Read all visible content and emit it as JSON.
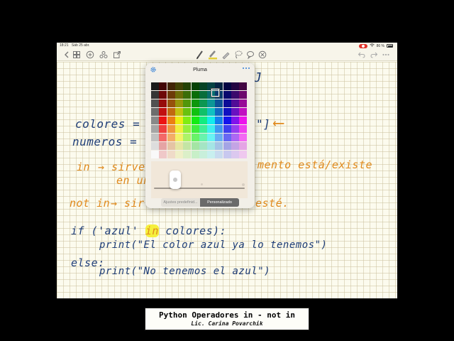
{
  "status_bar": {
    "time": "18:21",
    "date": "Sáb 25 abr.",
    "battery": "86 %",
    "icons": [
      "recording-icon",
      "wifi-icon",
      "battery-icon"
    ]
  },
  "toolbar": {
    "left_icons": [
      "back-icon",
      "thumbnails-icon",
      "add-page-icon",
      "shapes-icon",
      "export-icon"
    ],
    "tools": [
      "pen-icon",
      "highlighter-icon",
      "eraser-icon",
      "lasso-icon",
      "bubble-icon",
      "close-icon"
    ],
    "right_icons": [
      "undo-icon",
      "redo-icon",
      "more-icon"
    ],
    "active_tool_color": "#e6d13a"
  },
  "pen_popover": {
    "title": "Pluma",
    "segments": [
      "Ajustes predefinid...",
      "Personalizado"
    ],
    "selected_segment": "Personalizado"
  },
  "notes": {
    "partial_line_top": "J",
    "line1": "colores = [\"roja",
    "line1_tail": "\"]",
    "arrow": "⟵",
    "line2": "numeros = [2,",
    "in_lhs": "in",
    "in_arrow": "→ sirve",
    "in_rest": "mento está/existe",
    "in_line2": "en un",
    "notin_lhs": "not in",
    "notin_arrow": "→ sir",
    "notin_rest": "esté.",
    "if_open": "if ('azul' ",
    "if_in": "in",
    "if_close": " colores):",
    "print1": "print(\"El color azul ya lo tenemos\")",
    "else": "else:",
    "print2": "print(\"No tenemos el azul\")"
  },
  "caption": {
    "title": "Python Operadores in - not in",
    "subtitle": "Lic. Carina Povarchik"
  },
  "colors": {
    "ink_navy": "#1f3e78",
    "ink_orange": "#e08a1d",
    "highlight_yellow": "#f5ef3c",
    "paper": "#fcfbee"
  }
}
